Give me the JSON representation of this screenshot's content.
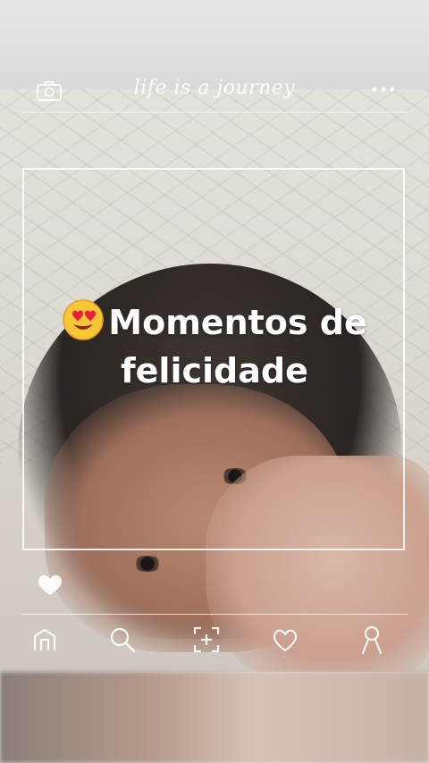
{
  "header": {
    "title": "life is a journey",
    "left_icon": "camera-icon",
    "right_icon": "more-icon"
  },
  "caption": {
    "emoji": "heart-eyes-emoji",
    "text": "Momentos de felicidade"
  },
  "like_icon": "heart-icon",
  "nav": {
    "items": [
      {
        "icon": "home-icon"
      },
      {
        "icon": "search-icon"
      },
      {
        "icon": "add-post-icon"
      },
      {
        "icon": "heart-icon"
      },
      {
        "icon": "profile-icon"
      }
    ]
  },
  "colors": {
    "overlay_line": "#ffffff",
    "caption_text": "#ffffff"
  }
}
